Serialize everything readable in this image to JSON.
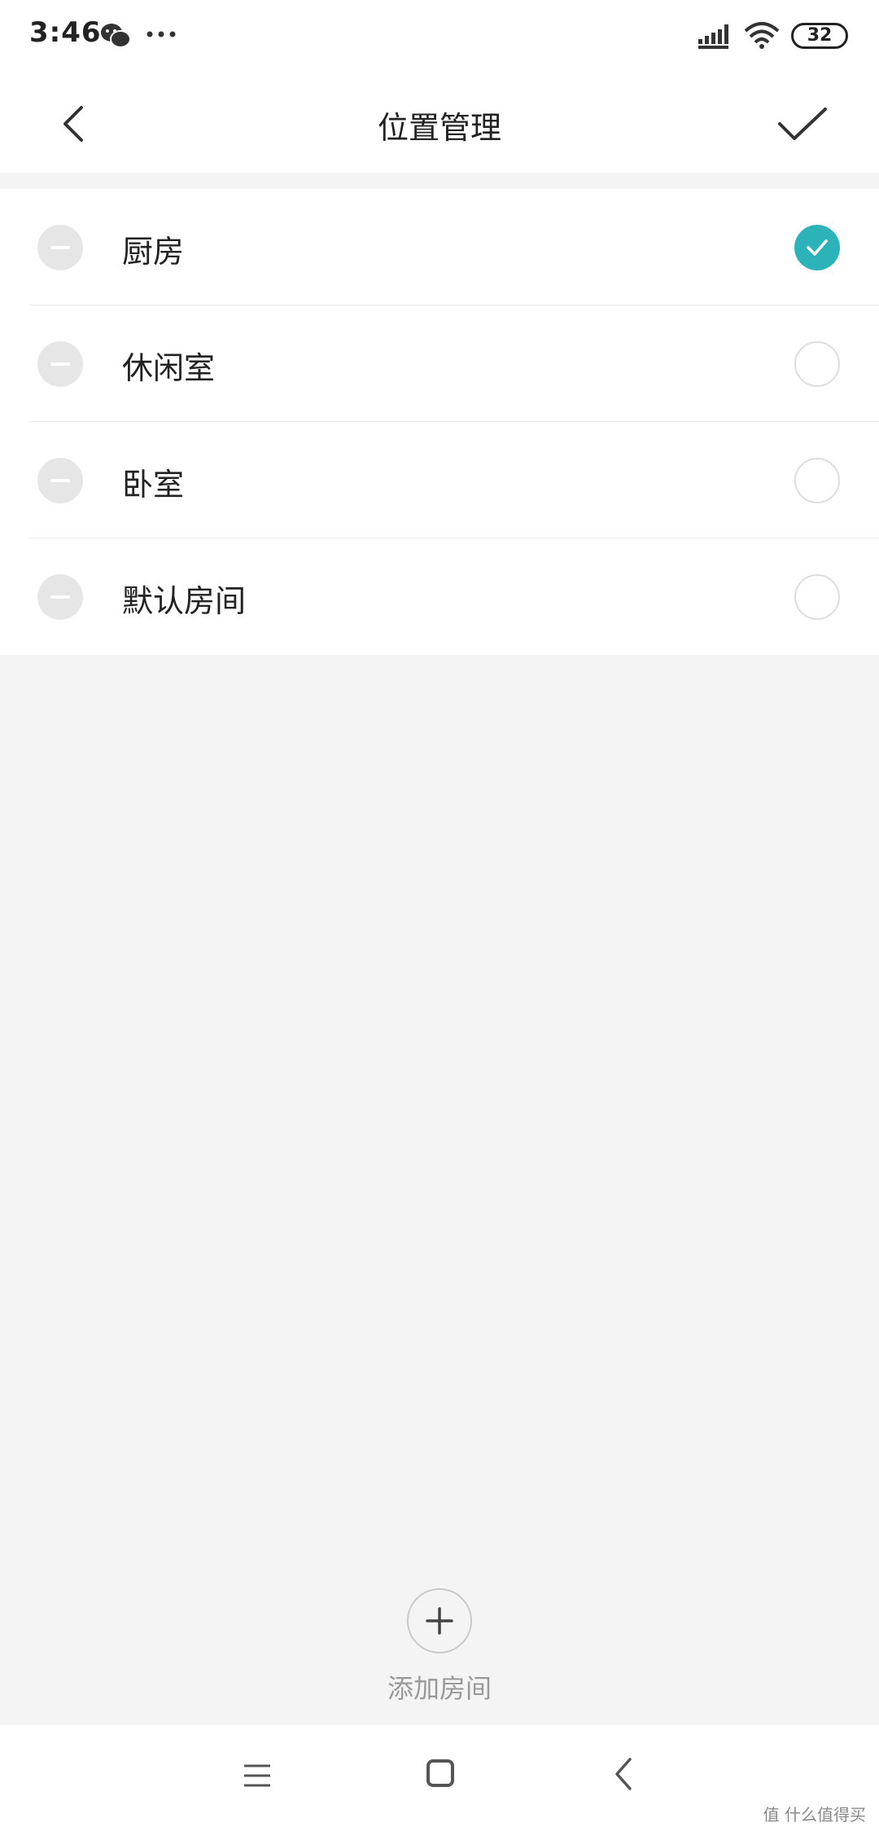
{
  "status_bar": {
    "time": "3:46",
    "battery": "32",
    "icons": [
      "wechat-icon",
      "more-dots-icon",
      "signal-icon",
      "wifi-icon",
      "battery-icon"
    ]
  },
  "header": {
    "title": "位置管理",
    "back_icon": "chevron-left-icon",
    "confirm_icon": "checkmark-icon"
  },
  "rooms": [
    {
      "name": "厨房",
      "selected": true
    },
    {
      "name": "休闲室",
      "selected": false
    },
    {
      "name": "卧室",
      "selected": false
    },
    {
      "name": "默认房间",
      "selected": false
    }
  ],
  "add_room": {
    "label": "添加房间",
    "icon": "plus-icon"
  },
  "nav_bar": {
    "icons": [
      "menu-icon",
      "home-icon",
      "back-icon"
    ]
  },
  "watermark": "值 什么值得买",
  "colors": {
    "accent": "#2cb3b9",
    "background": "#f4f4f5",
    "remove": "#e6e6e6"
  }
}
